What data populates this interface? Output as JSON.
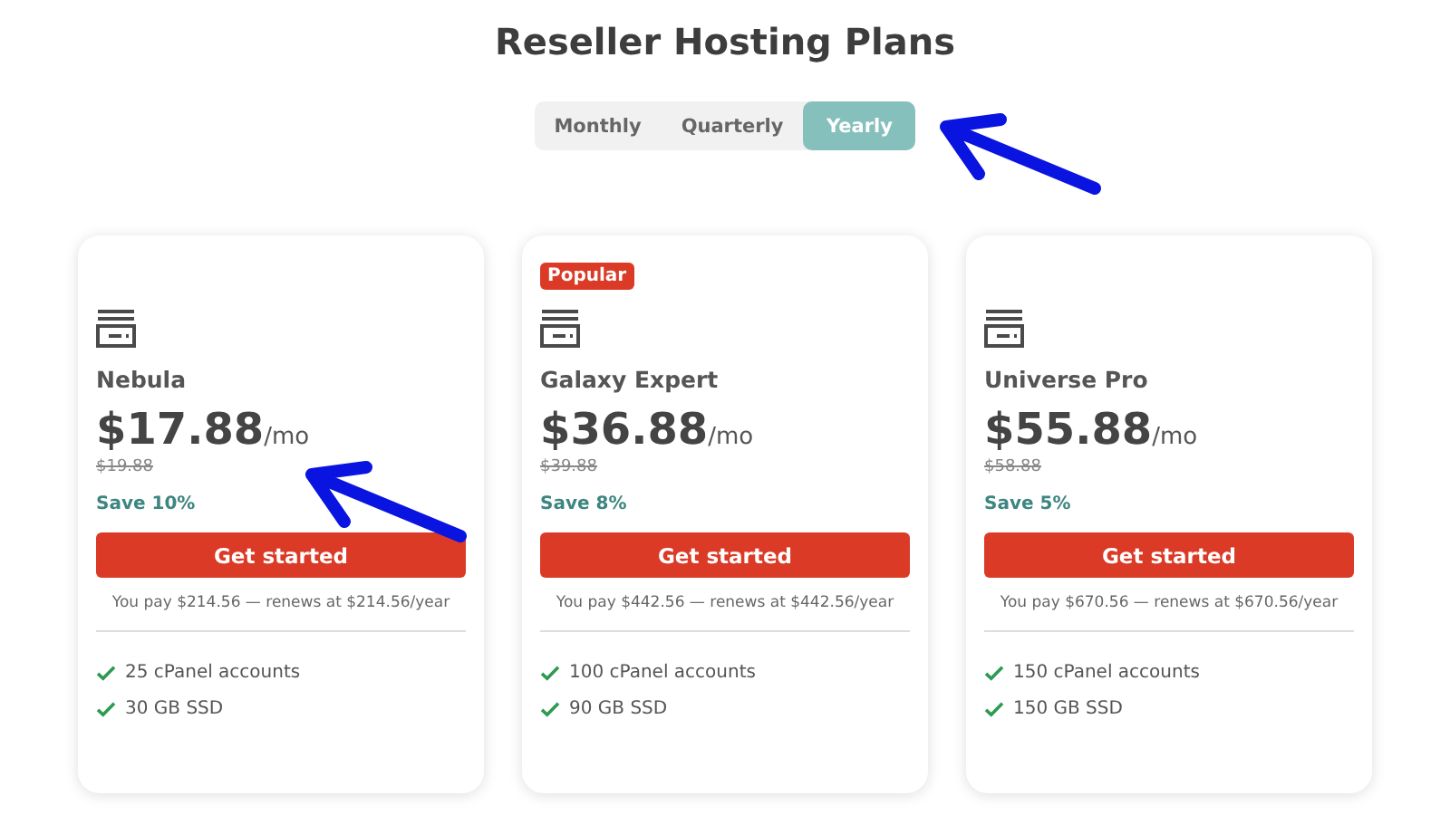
{
  "title": "Reseller Hosting Plans",
  "billing_tabs": [
    {
      "label": "Monthly",
      "selected": false
    },
    {
      "label": "Quarterly",
      "selected": false
    },
    {
      "label": "Yearly",
      "selected": true
    }
  ],
  "plans": [
    {
      "name": "Nebula",
      "price": "$17.88",
      "period": "/mo",
      "old_price": "$19.88",
      "save": "Save 10%",
      "button": "Get started",
      "note": "You pay $214.56 — renews at $214.56/year",
      "features": [
        "25 cPanel accounts",
        "30 GB SSD"
      ]
    },
    {
      "badge": "Popular",
      "name": "Galaxy Expert",
      "price": "$36.88",
      "period": "/mo",
      "old_price": "$39.88",
      "save": "Save 8%",
      "button": "Get started",
      "note": "You pay $442.56 — renews at $442.56/year",
      "features": [
        "100 cPanel accounts",
        "90 GB SSD"
      ]
    },
    {
      "name": "Universe Pro",
      "price": "$55.88",
      "period": "/mo",
      "old_price": "$58.88",
      "save": "Save 5%",
      "button": "Get started",
      "note": "You pay $670.56 — renews at $670.56/year",
      "features": [
        "150 cPanel accounts",
        "150 GB SSD"
      ]
    }
  ]
}
